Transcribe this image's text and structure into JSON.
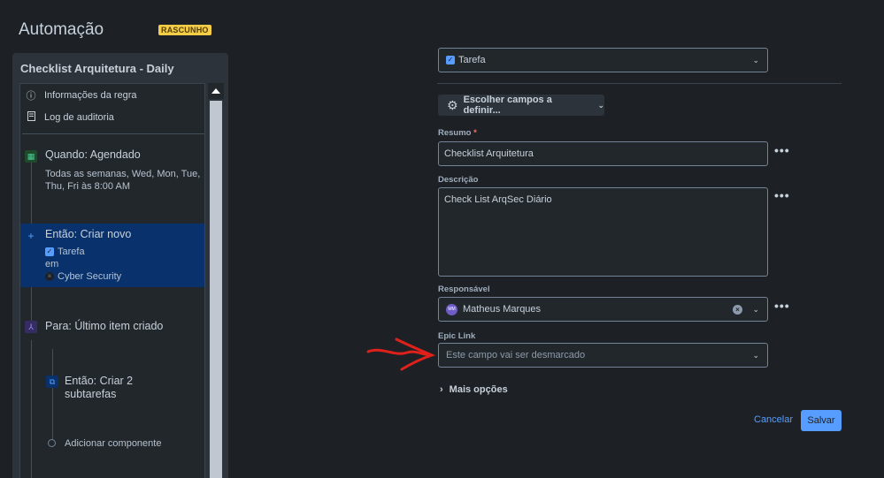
{
  "header": {
    "title": "Automação",
    "badge": "RASCUNHO"
  },
  "rule": {
    "name": "Checklist Arquitetura - Daily",
    "menu": [
      {
        "label": "Informações da regra",
        "icon": "info-icon"
      },
      {
        "label": "Log de auditoria",
        "icon": "document-icon"
      }
    ],
    "trigger": {
      "title": "Quando: Agendado",
      "line1": "Todas as semanas, Wed, Mon, Tue,",
      "line2": "Thu, Fri às 8:00 AM",
      "icon": "calendar-icon"
    },
    "action": {
      "title": "Então: Criar novo",
      "issue_type": "Tarefa",
      "in_label": "em",
      "project": "Cyber Security",
      "icon": "plus-icon"
    },
    "branch": {
      "title": "Para: Último item criado",
      "icon": "branch-icon"
    },
    "sub_action": {
      "line1": "Então: Criar 2",
      "line2": "subtarefas",
      "icon": "subtasks-icon"
    },
    "add_component": "Adicionar componente"
  },
  "form": {
    "issue_type_value": "Tarefa",
    "choose_fields": "Escolher campos a definir...",
    "summary": {
      "label": "Resumo",
      "required_mark": "*",
      "value": "Checklist Arquitetura"
    },
    "description": {
      "label": "Descrição",
      "value": "Check List ArqSec Diário"
    },
    "assignee": {
      "label": "Responsável",
      "initials": "MM",
      "value": "Matheus Marques"
    },
    "epic_link": {
      "label": "Epic Link",
      "placeholder": "Este campo vai ser desmarcado"
    },
    "more_options": "Mais opções",
    "cancel": "Cancelar",
    "save": "Salvar",
    "more_icon": "•••"
  },
  "colors": {
    "accent": "#579dff",
    "badge": "#f5cd47",
    "selected_card": "#09326c",
    "annotation": "#e0201a"
  }
}
